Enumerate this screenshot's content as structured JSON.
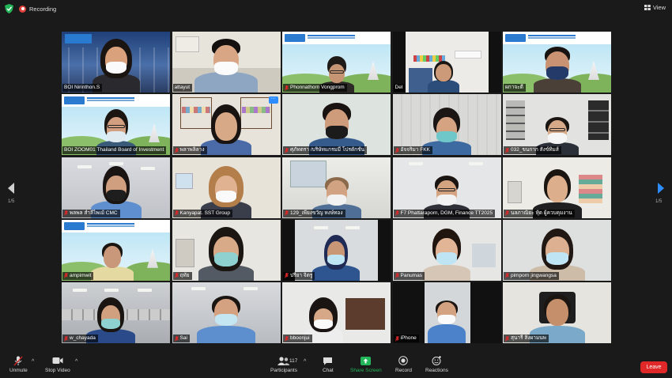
{
  "topbar": {
    "recording_label": "Recording",
    "view_label": "View"
  },
  "paging": {
    "left_label": "1/5",
    "right_label": "1/5"
  },
  "participants": [
    {
      "name": "BOI Nirinthon.S",
      "muted": false,
      "active": false
    },
    {
      "name": "attayut",
      "muted": false,
      "active": false
    },
    {
      "name": "Phonnathorn Vongprom",
      "muted": true,
      "active": false
    },
    {
      "name": "Del",
      "muted": false,
      "active": false
    },
    {
      "name": "ผกาจะดี",
      "muted": false,
      "active": false
    },
    {
      "name": "BOI ZOOM01 Thailand Board of Investment",
      "muted": false,
      "active": true
    },
    {
      "name": "พลาพลิลาง",
      "muted": true,
      "active": false
    },
    {
      "name": "ศุภัทตรา /บริษัทแกรมมี่ โปรดักชั่น",
      "muted": true,
      "active": false
    },
    {
      "name": "อัจจริมา FKK",
      "muted": true,
      "active": false
    },
    {
      "name": "032_ขนกาก สังข์ทิมส์",
      "muted": true,
      "active": false
    },
    {
      "name": "พลพล สำลีไพเม้ CMC",
      "muted": true,
      "active": false
    },
    {
      "name": "Kanyapat. SST Group",
      "muted": true,
      "active": false
    },
    {
      "name": "129_เพียงขวัญ หงษ์ทอง",
      "muted": true,
      "active": false
    },
    {
      "name": "F7 Phattaraporn, DGM, Finance TT2025",
      "muted": true,
      "active": false
    },
    {
      "name": "นลภาณิยะ หุ้ด ผู้ควบคุมงาน",
      "muted": true,
      "active": false
    },
    {
      "name": "ampimwit",
      "muted": true,
      "active": false
    },
    {
      "name": "ฤทัย",
      "muted": true,
      "active": false
    },
    {
      "name": "ปรียา จิตรู",
      "muted": true,
      "active": false
    },
    {
      "name": "Panumas",
      "muted": true,
      "active": false
    },
    {
      "name": "pimporn jingwangsa",
      "muted": true,
      "active": false
    },
    {
      "name": "w_chayada",
      "muted": true,
      "active": false
    },
    {
      "name": "Sai",
      "muted": true,
      "active": false
    },
    {
      "name": "bboonjui",
      "muted": true,
      "active": false
    },
    {
      "name": "iPhone",
      "muted": true,
      "active": false
    },
    {
      "name": "สุนารี สิงผามนพ",
      "muted": true,
      "active": false
    }
  ],
  "toolbar": {
    "unmute_label": "Unmute",
    "stop_video_label": "Stop Video",
    "participants_label": "Participants",
    "participants_count": "117",
    "chat_label": "Chat",
    "share_label": "Share Screen",
    "record_label": "Record",
    "reactions_label": "Reactions",
    "leave_label": "Leave"
  },
  "colors": {
    "accent_green": "#22b559",
    "leave_red": "#e02828",
    "active_border": "#d7dd4a",
    "recording_red": "#e0413b"
  }
}
